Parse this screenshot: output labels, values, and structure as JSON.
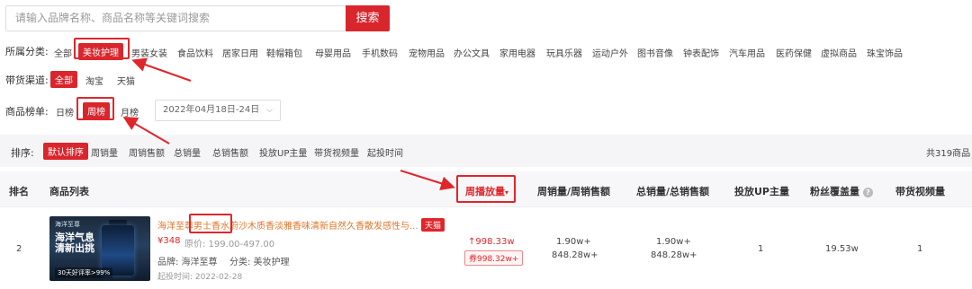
{
  "search": {
    "placeholder": "请输入品牌名称、商品名称等关键词搜索",
    "button": "搜索"
  },
  "category": {
    "label": "所属分类:",
    "items": [
      "全部",
      "美妆护理",
      "男装女装",
      "食品饮料",
      "居家日用",
      "鞋帽箱包",
      "母婴用品",
      "手机数码",
      "宠物用品",
      "办公文具",
      "家用电器",
      "玩具乐器",
      "运动户外",
      "图书音像",
      "钟表配饰",
      "汽车用品",
      "医药保健",
      "虚拟商品",
      "珠宝饰品"
    ],
    "active": "美妆护理"
  },
  "channel": {
    "label": "带货渠道:",
    "items": [
      "全部",
      "淘宝",
      "天猫"
    ],
    "active": "全部"
  },
  "ranking": {
    "label": "商品榜单:",
    "items": [
      "日榜",
      "周榜",
      "月榜"
    ],
    "active": "周榜",
    "date_range": "2022年04月18日-24日"
  },
  "sort": {
    "label": "排序:",
    "items": [
      "默认排序",
      "周销量",
      "周销售额",
      "总销量",
      "总销售额",
      "投放UP主量",
      "带货视频量",
      "起投时间"
    ],
    "active": "默认排序",
    "total": "共319商品"
  },
  "table": {
    "headers": {
      "rank": "排名",
      "product": "商品列表",
      "plays": "周播放量",
      "weekly": "周销量/周销售额",
      "total": "总销量/总销售额",
      "up": "投放UP主量",
      "fans": "粉丝覆盖量",
      "videos": "带货视频量"
    },
    "rows": [
      {
        "rank": "2",
        "thumb_brand": "海洋至尊",
        "thumb_slogan1": "海洋气息",
        "thumb_slogan2": "清新出挑",
        "thumb_footer": "30天好评率>99%",
        "title": "海洋至尊男士香水蔚沙木质香淡雅香味清新自然久香散发感性与...",
        "platform": "天猫",
        "price": "¥348",
        "original_price": "原价: 199.00-497.00",
        "brand": "品牌: 海洋至尊",
        "category": "分类: 美妆护理",
        "start_time": "起投时间: 2022-02-28",
        "plays": "↑998.33w",
        "plays_pill": "券998.32w+",
        "weekly_sales": "1.90w+",
        "weekly_revenue": "848.28w+",
        "total_sales": "1.90w+",
        "total_revenue": "848.28w+",
        "up_count": "1",
        "fans": "19.53w",
        "videos": "1"
      }
    ]
  }
}
